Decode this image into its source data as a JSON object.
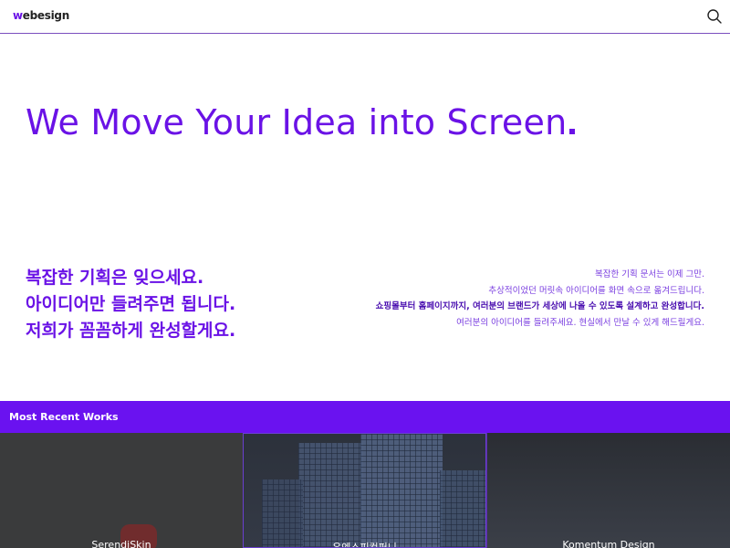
{
  "header": {
    "logo_w": "w",
    "logo_rest": "ebesign",
    "search_icon": "search-icon"
  },
  "hero": {
    "title": "We Move Your Idea into Screen"
  },
  "lead": {
    "lines": [
      "복잡한 기획은 잊으세요.",
      "아이디어만 들려주면 됩니다.",
      "저희가 꼼꼼하게 완성할게요."
    ]
  },
  "description": {
    "lines": [
      "복잡한 기획 문서는 이제 그만.",
      "추상적이었던 머릿속 아이디어를 화면 속으로 옮겨드립니다.",
      "쇼핑몰부터 홈페이지까지, 여러분의 브랜드가 세상에 나올 수 있도록 설계하고 완성합니다.",
      "여러분의 아이디어를 들려주세요. 현실에서 만날 수 있게 해드릴게요."
    ]
  },
  "works": {
    "section_title": "Most Recent Works",
    "items": [
      {
        "title": "SerendiSkin"
      },
      {
        "title": "유엔스피컴퍼니"
      },
      {
        "title": "Komentum Design"
      }
    ]
  },
  "colors": {
    "accent": "#6a12e6",
    "bar": "#6a12f0",
    "text_light": "#ffffff"
  }
}
